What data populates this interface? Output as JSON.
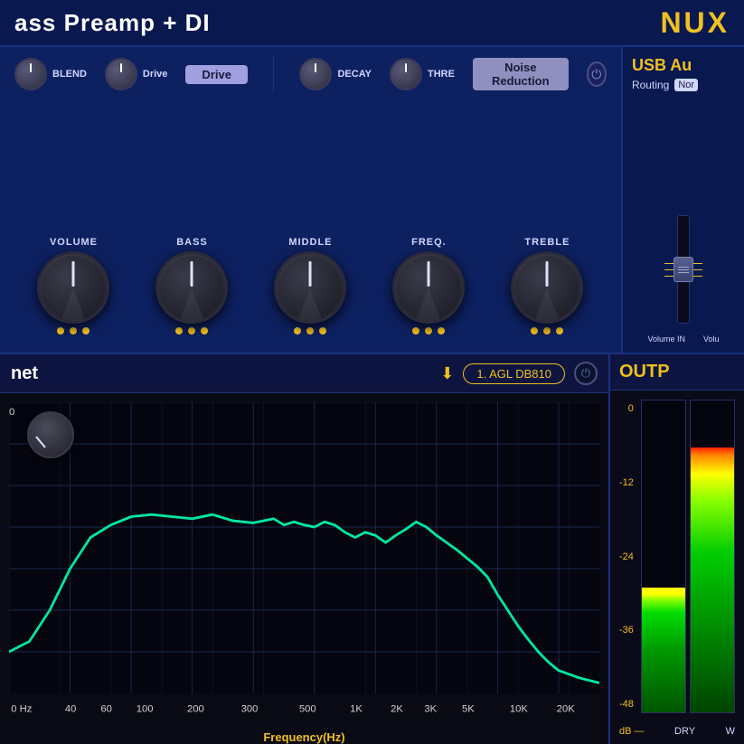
{
  "header": {
    "title": "ass Preamp + DI",
    "brand": "NUX"
  },
  "top_controls": {
    "blend_label": "BLEND",
    "drive_label": "Drive",
    "decay_label": "DECAY",
    "thre_label": "THRE",
    "drive_tab": "Drive",
    "noise_tab": "Noise Reduction",
    "power_icon": "⏻"
  },
  "knobs": [
    {
      "label": "VOLUME",
      "dots": 3
    },
    {
      "label": "BASS",
      "dots": 3
    },
    {
      "label": "MIDDLE",
      "dots": 3
    },
    {
      "label": "FREQ.",
      "dots": 3
    },
    {
      "label": "TREBLE",
      "dots": 3
    }
  ],
  "usb_panel": {
    "title": "USB Au",
    "routing_label": "Routing",
    "routing_value": "Nor",
    "vol_in_label": "Volume IN",
    "vol_out_label": "Volu"
  },
  "cabinet": {
    "title": "net",
    "download_icon": "⬇",
    "preset_name": "1. AGL DB810",
    "power_icon": "⏻"
  },
  "freq_chart": {
    "x_axis_label": "Frequency(Hz)",
    "x_labels": [
      "0 Hz",
      "40",
      "60",
      "100",
      "200",
      "300",
      "500",
      "1K",
      "2K",
      "3K",
      "5K",
      "10K",
      "20K"
    ],
    "y_labels": [
      "0",
      "",
      "",
      "",
      "",
      "",
      "",
      ""
    ]
  },
  "output": {
    "title": "OUTP",
    "db_label": "dB —",
    "dry_label": "DRY",
    "wet_label": "W",
    "meter_labels": [
      "0",
      "-12",
      "-24",
      "-36",
      "-48"
    ]
  }
}
